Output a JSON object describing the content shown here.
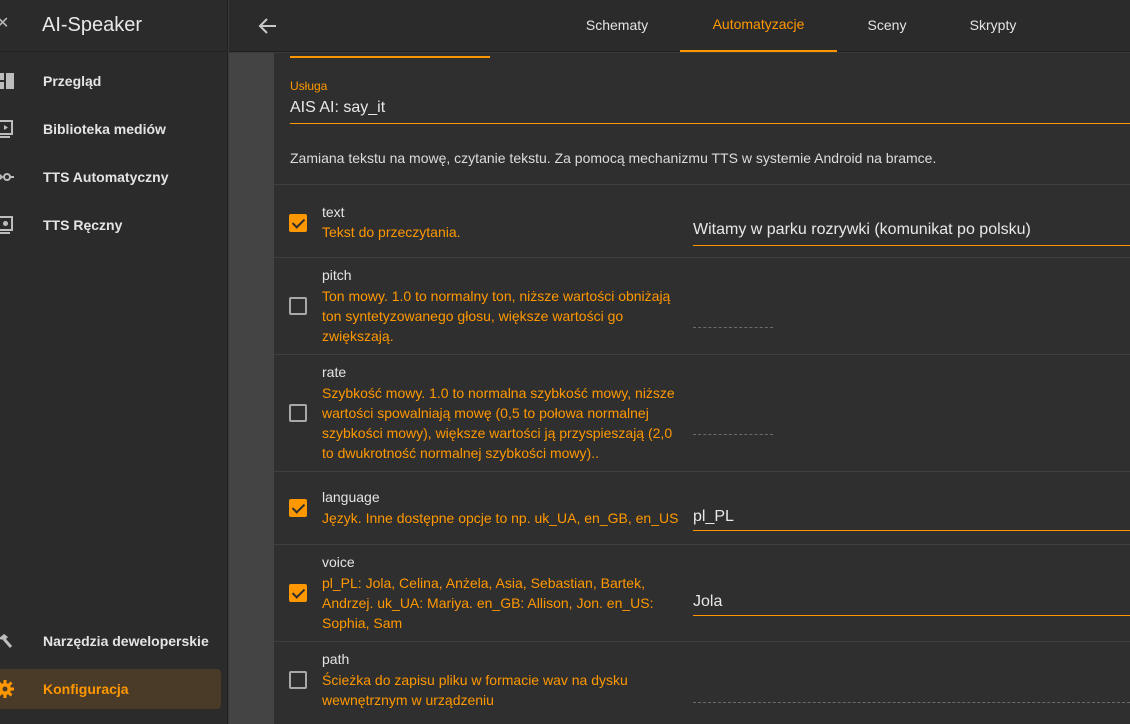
{
  "app": {
    "title": "AI-Speaker"
  },
  "sidebar": {
    "items": [
      {
        "label": "Przegląd",
        "icon": "dashboard-icon"
      },
      {
        "label": "Biblioteka mediów",
        "icon": "media-library-icon"
      },
      {
        "label": "TTS Automatyczny",
        "icon": "automation-icon"
      },
      {
        "label": "TTS Ręczny",
        "icon": "tts-manual-icon"
      },
      {
        "label": "Narzędzia deweloperskie",
        "icon": "hammer-icon"
      },
      {
        "label": "Konfiguracja",
        "icon": "gear-icon"
      }
    ]
  },
  "tabs": [
    "Schematy",
    "Automatyzacje",
    "Sceny",
    "Skrypty"
  ],
  "active_tab": "Automatyzacje",
  "service": {
    "label": "Usługa",
    "value": "AIS AI: say_it"
  },
  "description": "Zamiana tekstu na mowę, czytanie tekstu. Za pomocą mechanizmu TTS w systemie Android na bramce.",
  "params": [
    {
      "name": "text",
      "checked": true,
      "desc": "Tekst do przeczytania.",
      "value": "Witamy w parku rozrywki (komunikat po polsku)"
    },
    {
      "name": "pitch",
      "checked": false,
      "desc": "Ton mowy. 1.0 to normalny ton, niższe wartości obniżają ton syntetyzowanego głosu, większe wartości go zwiększają.",
      "value": ""
    },
    {
      "name": "rate",
      "checked": false,
      "desc": "Szybkość mowy. 1.0 to normalna szybkość mowy, niższe wartości spowalniają mowę (0,5 to połowa normalnej szybkości mowy), większe wartości ją przyspieszają (2,0 to dwukrotność normalnej szybkości mowy)..",
      "value": ""
    },
    {
      "name": "language",
      "checked": true,
      "desc": "Język. Inne dostępne opcje to np. uk_UA, en_GB, en_US",
      "value": "pl_PL"
    },
    {
      "name": "voice",
      "checked": true,
      "desc": "pl_PL: Jola, Celina, Anżela, Asia, Sebastian, Bartek, Andrzej. uk_UA: Mariya. en_GB: Allison, Jon. en_US: Sophia, Sam",
      "value": "Jola"
    },
    {
      "name": "path",
      "checked": false,
      "desc": "Ścieżka do zapisu pliku w formacie wav na dysku wewnętrznym w urządzeniu",
      "value": ""
    }
  ],
  "colors": {
    "accent": "#ff9800",
    "sidebar_bg": "#2b2b2b",
    "panel_bg": "#2f2f2f"
  }
}
